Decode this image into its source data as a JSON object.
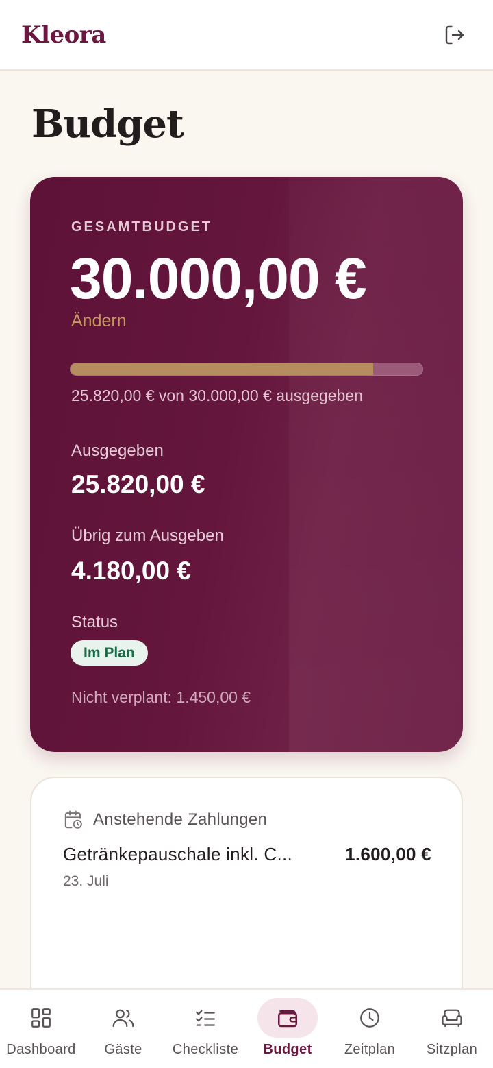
{
  "header": {
    "brand": "Kleora",
    "logout_icon": "logout-icon"
  },
  "page": {
    "title": "Budget"
  },
  "budget": {
    "total_label": "GESAMTBUDGET",
    "total_amount": "30.000,00 €",
    "edit_label": "Ändern",
    "progress_fraction": 0.86,
    "progress_text": "25.820,00 € von 30.000,00 € ausgegeben",
    "spent_label": "Ausgegeben",
    "spent_value": "25.820,00 €",
    "remaining_label": "Übrig zum Ausgeben",
    "remaining_value": "4.180,00 €",
    "status_label": "Status",
    "status_value": "Im Plan",
    "unplanned_text": "Nicht verplant: 1.450,00 €"
  },
  "payments": {
    "title": "Anstehende Zahlungen",
    "icon": "calendar-clock-icon",
    "items": [
      {
        "name": "Getränkepauschale inkl. C...",
        "amount": "1.600,00 €",
        "date": "23. Juli"
      }
    ]
  },
  "nav": {
    "items": [
      {
        "label": "Dashboard",
        "icon": "dashboard-icon"
      },
      {
        "label": "Gäste",
        "icon": "guests-icon"
      },
      {
        "label": "Checkliste",
        "icon": "checklist-icon"
      },
      {
        "label": "Budget",
        "icon": "wallet-icon",
        "active": true
      },
      {
        "label": "Zeitplan",
        "icon": "clock-icon"
      },
      {
        "label": "Sitzplan",
        "icon": "sofa-icon"
      }
    ]
  },
  "colors": {
    "brand": "#6b1740",
    "card_bg": "#64163c",
    "accent_gold": "#c4975e",
    "status_green": "#1b6b47",
    "page_bg": "#faf6f0"
  }
}
